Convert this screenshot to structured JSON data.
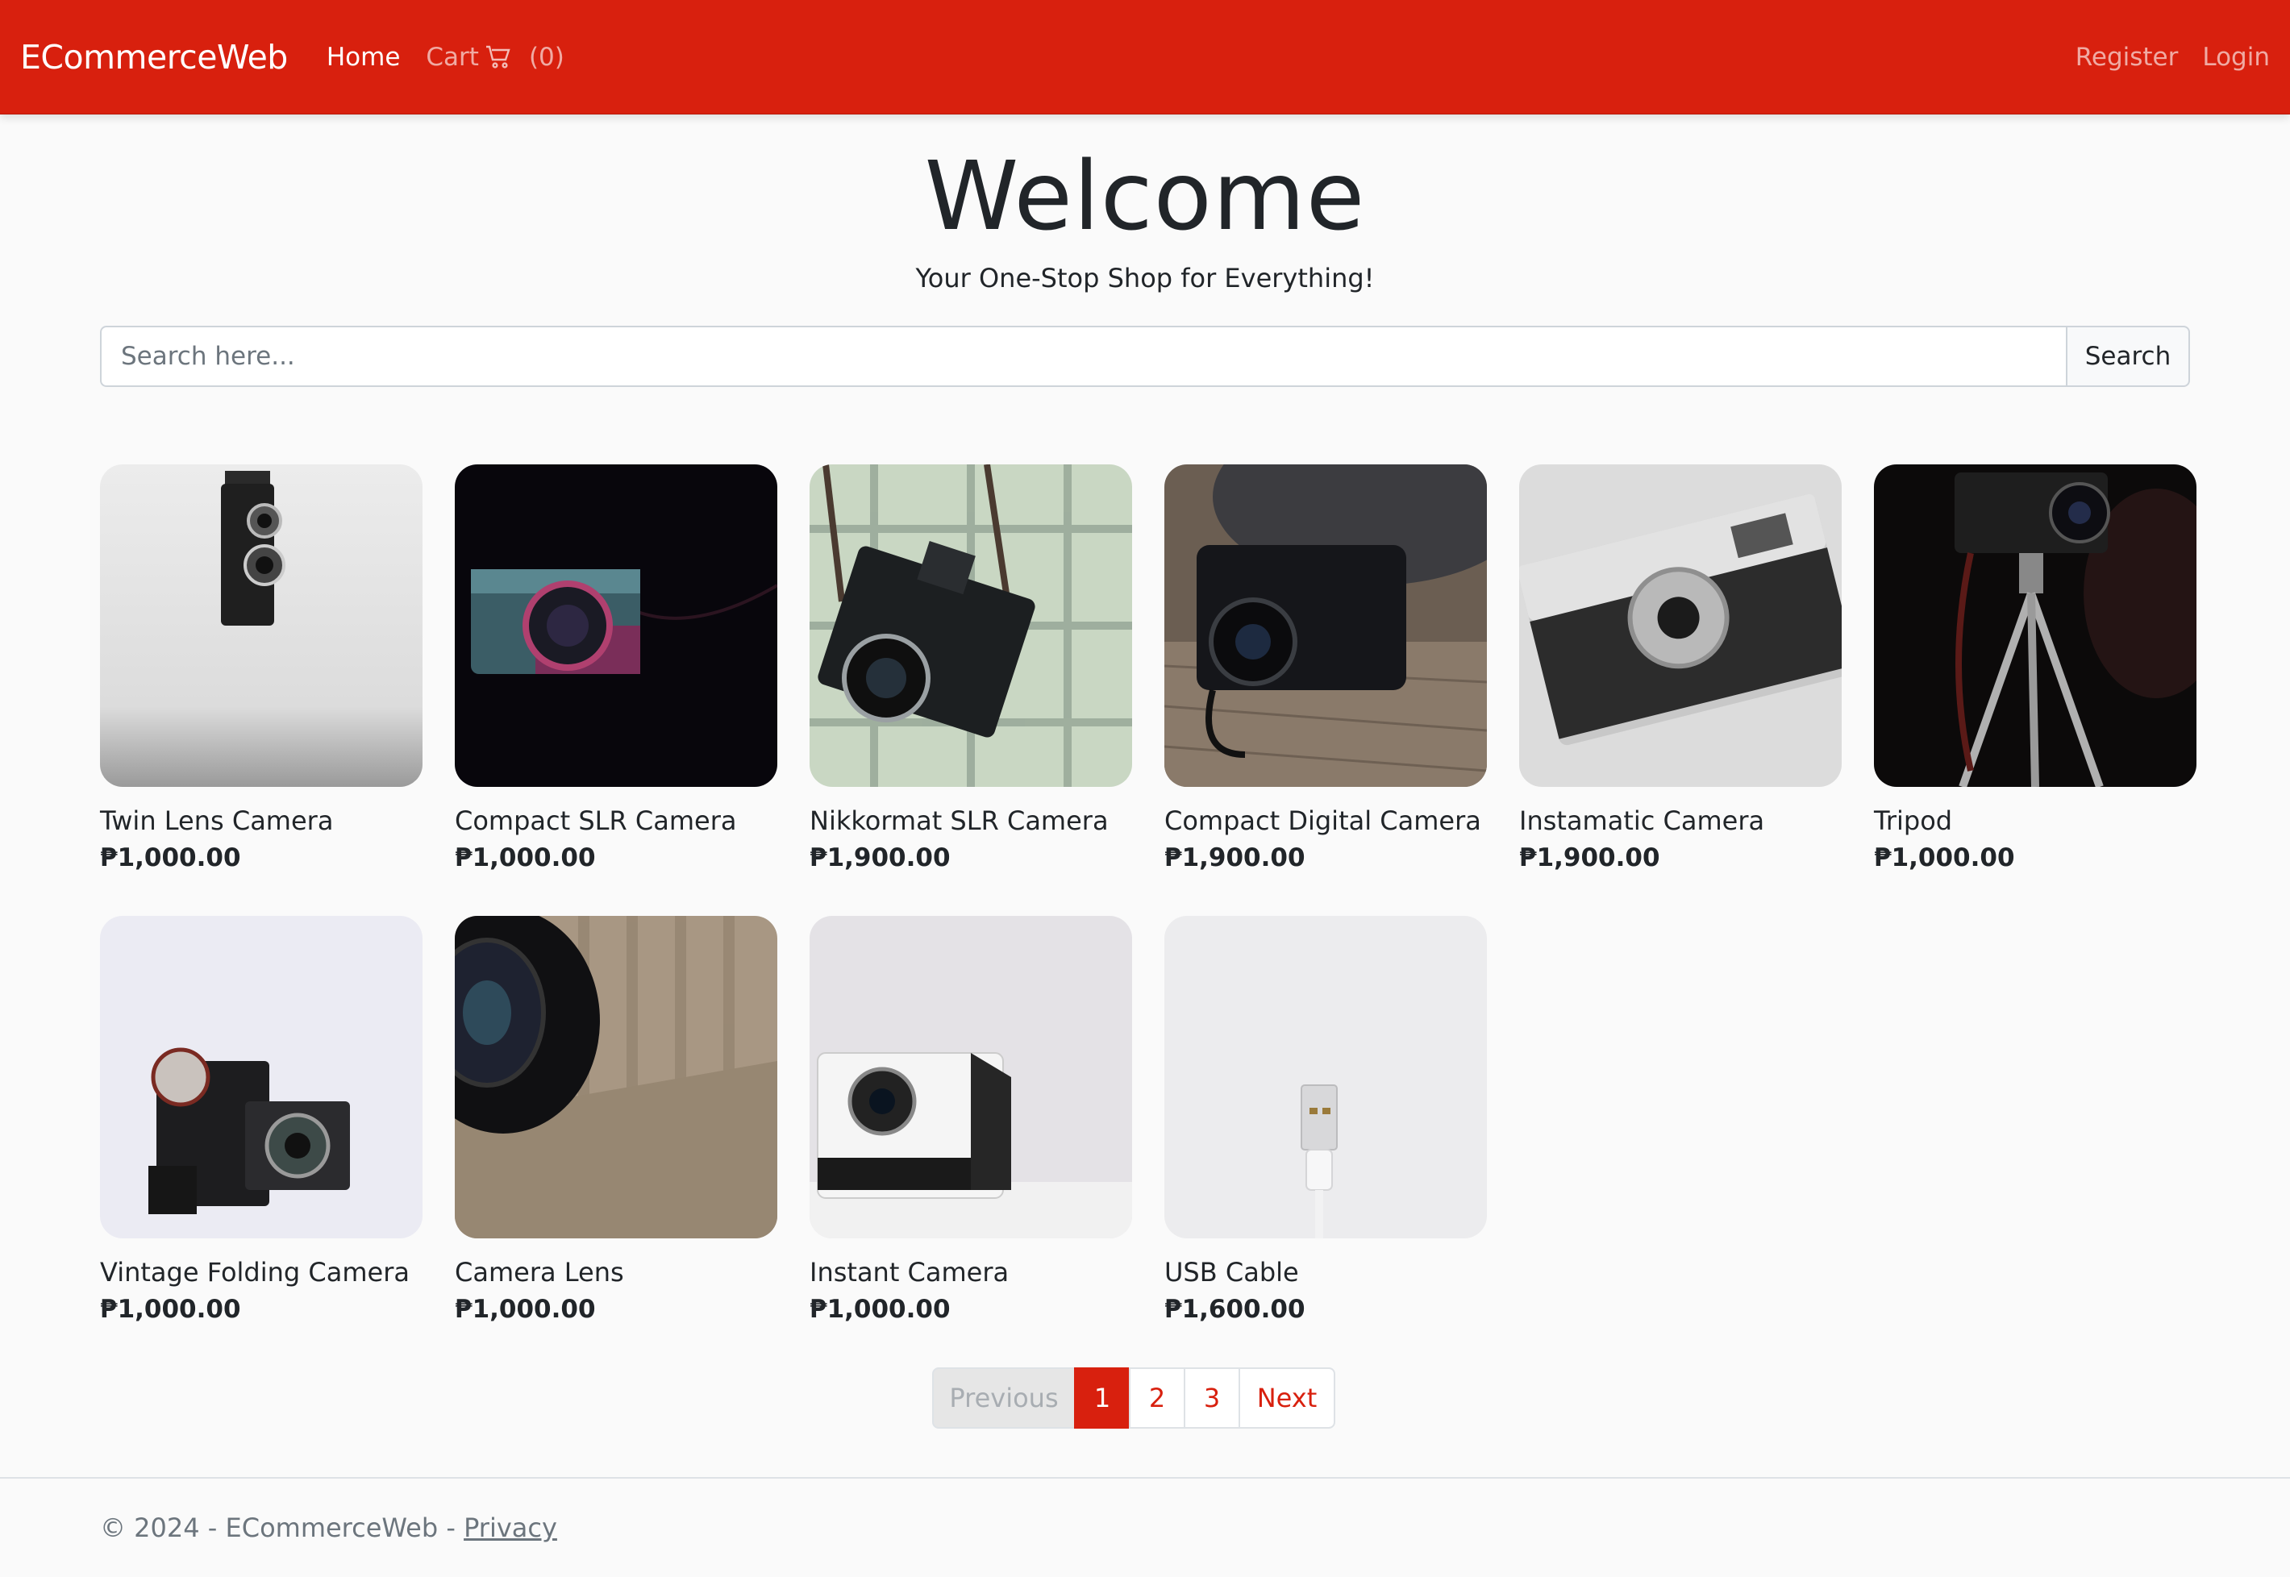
{
  "navbar": {
    "brand": "ECommerceWeb",
    "home_label": "Home",
    "cart_label": "Cart",
    "cart_count": "(0)",
    "register_label": "Register",
    "login_label": "Login",
    "accent_color": "#d8200e"
  },
  "hero": {
    "title": "Welcome",
    "subtitle": "Your One-Stop Shop for Everything!"
  },
  "search": {
    "placeholder": "Search here...",
    "value": "",
    "button_label": "Search"
  },
  "products": [
    {
      "name": "Twin Lens Camera",
      "price": "₱1,000.00",
      "image": "twin-lens-camera-photo"
    },
    {
      "name": "Compact SLR Camera",
      "price": "₱1,000.00",
      "image": "compact-slr-camera-photo"
    },
    {
      "name": "Nikkormat SLR Camera",
      "price": "₱1,900.00",
      "image": "nikkormat-camera-photo"
    },
    {
      "name": "Compact Digital Camera",
      "price": "₱1,900.00",
      "image": "compact-digital-camera-photo"
    },
    {
      "name": "Instamatic Camera",
      "price": "₱1,900.00",
      "image": "instamatic-camera-photo"
    },
    {
      "name": "Tripod",
      "price": "₱1,000.00",
      "image": "tripod-photo"
    },
    {
      "name": "Vintage Folding Camera",
      "price": "₱1,000.00",
      "image": "vintage-folding-camera-photo"
    },
    {
      "name": "Camera Lens",
      "price": "₱1,000.00",
      "image": "camera-lens-photo"
    },
    {
      "name": "Instant Camera",
      "price": "₱1,000.00",
      "image": "instant-camera-photo"
    },
    {
      "name": "USB Cable",
      "price": "₱1,600.00",
      "image": "usb-cable-photo"
    }
  ],
  "pagination": {
    "previous_label": "Previous",
    "pages": [
      "1",
      "2",
      "3"
    ],
    "active_page": "1",
    "next_label": "Next"
  },
  "footer": {
    "copyright": "© 2024 - ECommerceWeb - ",
    "privacy_label": "Privacy"
  }
}
